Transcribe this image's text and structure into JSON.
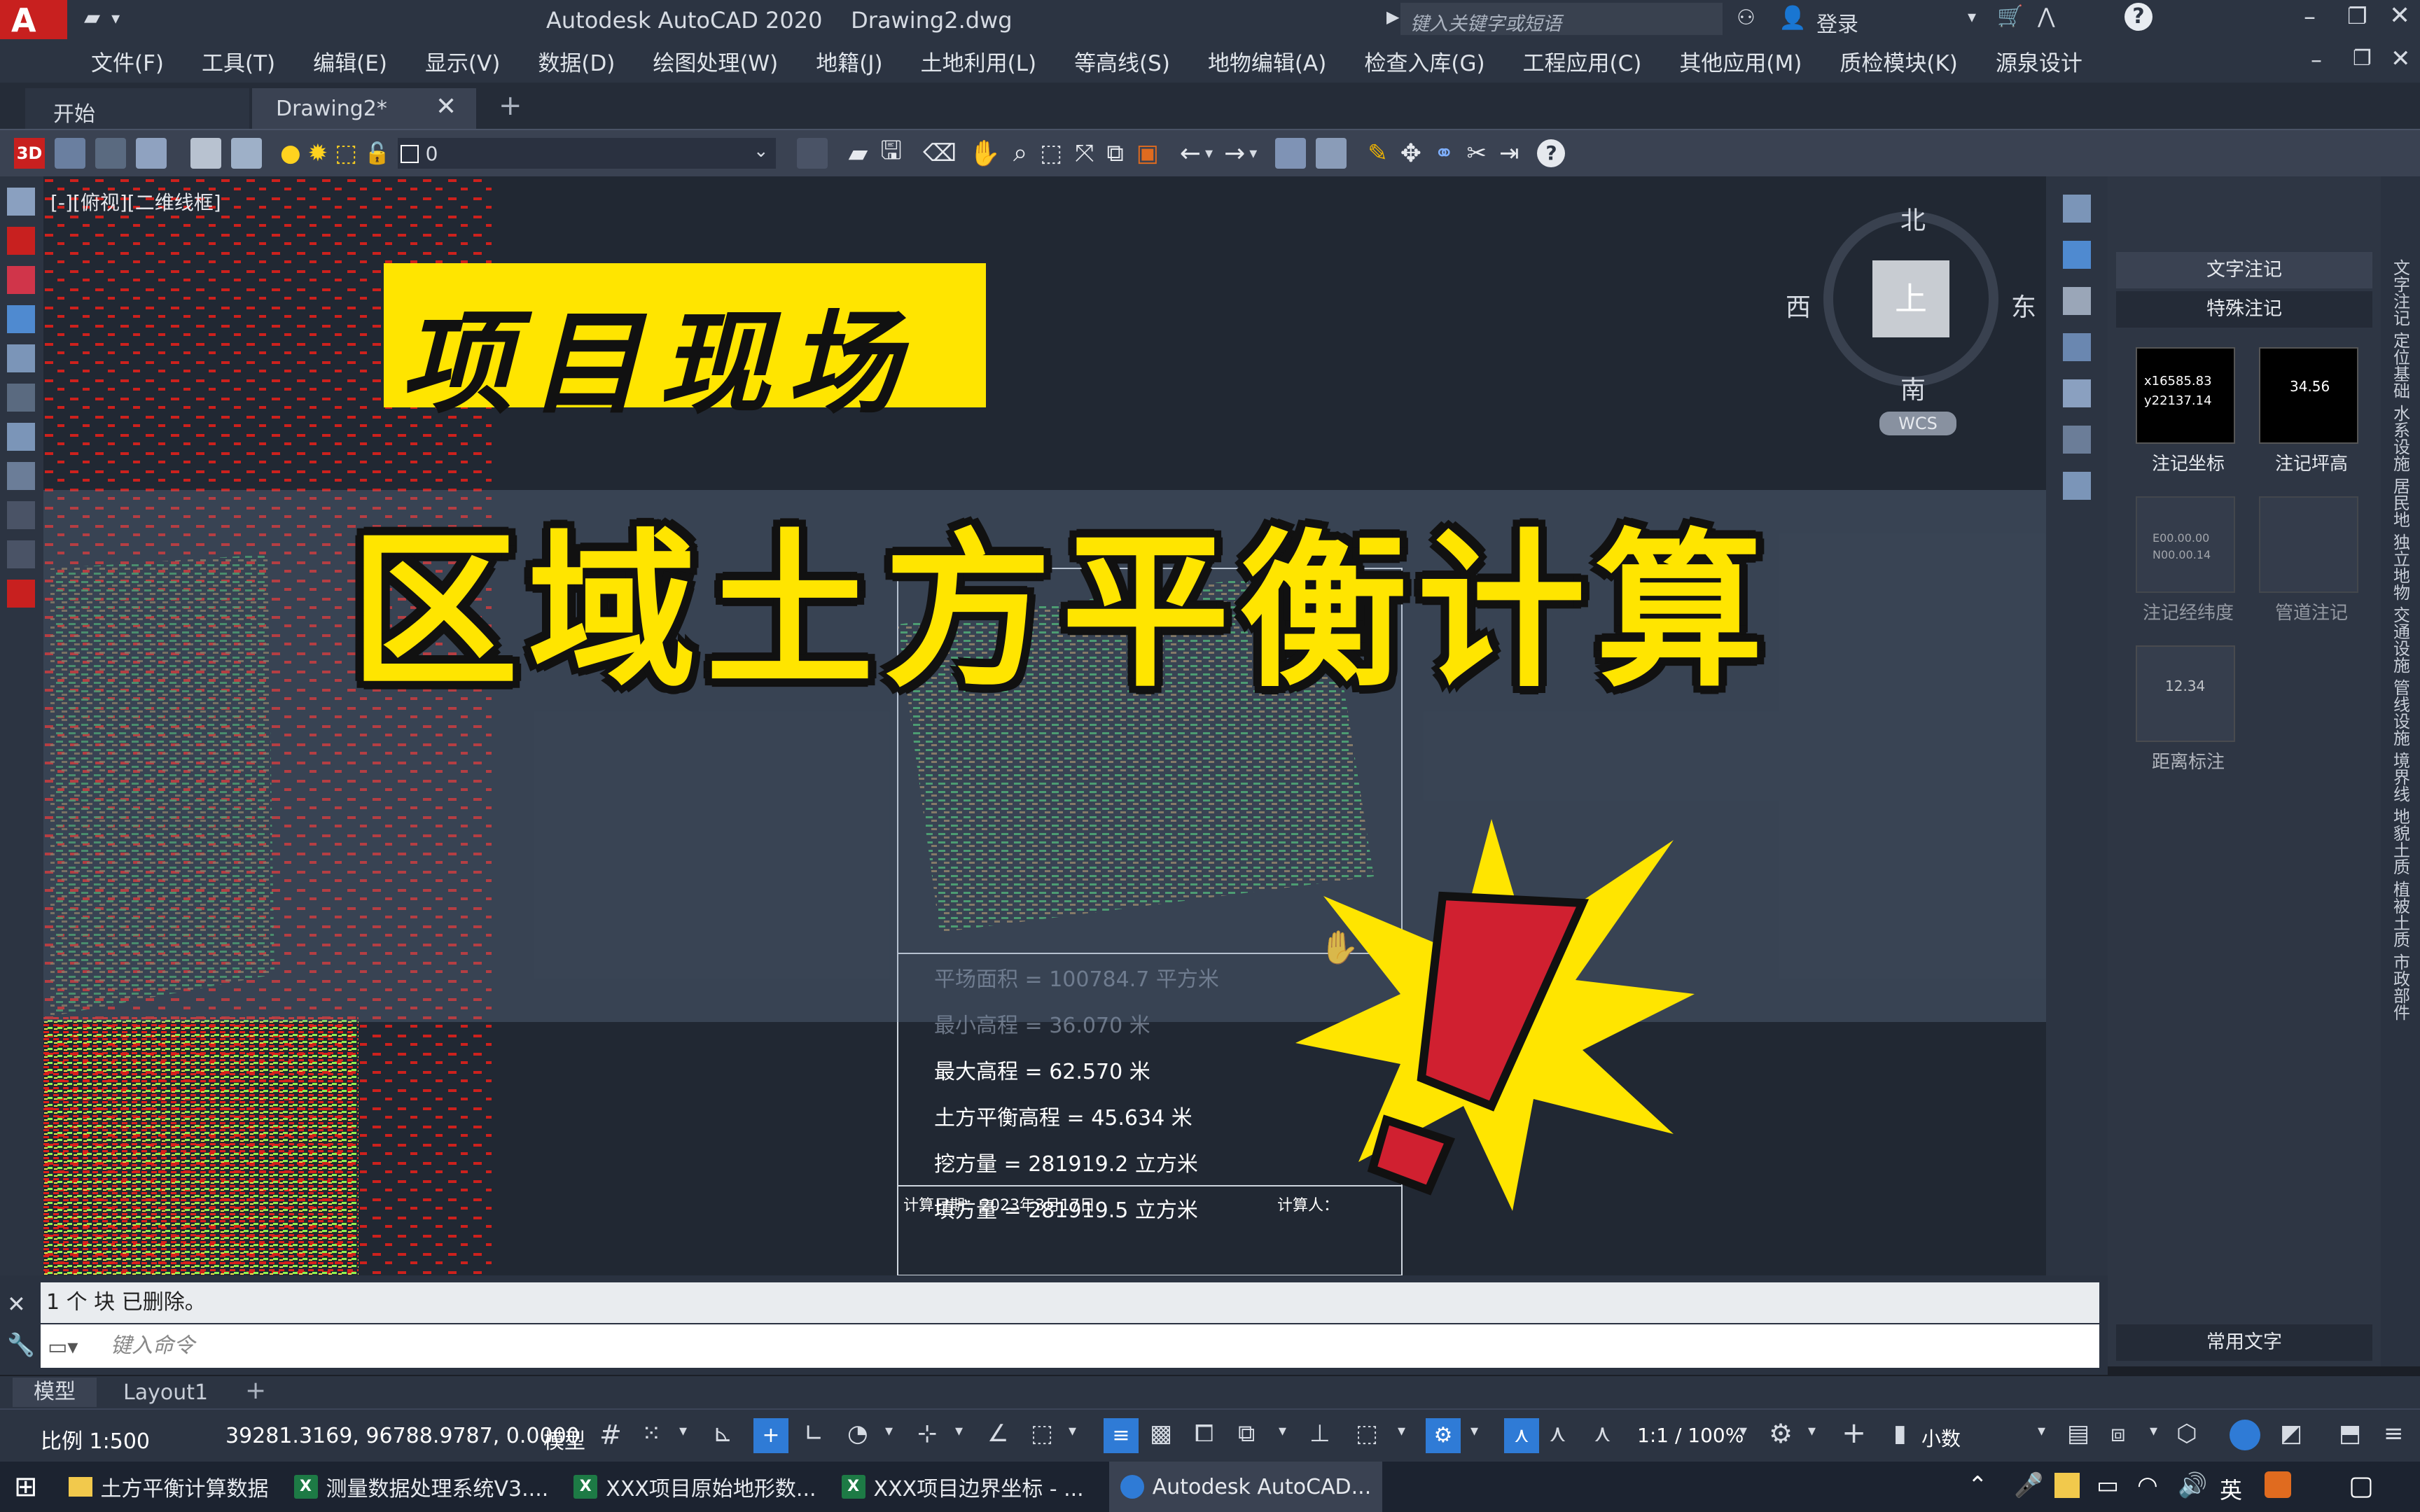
{
  "titlebar": {
    "app_title": "Autodesk AutoCAD 2020",
    "document": "Drawing2.dwg",
    "search_placeholder": "键入关键字或短语",
    "login": "登录"
  },
  "menus": [
    "文件(F)",
    "工具(T)",
    "编辑(E)",
    "显示(V)",
    "数据(D)",
    "绘图处理(W)",
    "地籍(J)",
    "土地利用(L)",
    "等高线(S)",
    "地物编辑(A)",
    "检查入库(G)",
    "工程应用(C)",
    "其他应用(M)",
    "质检模块(K)",
    "源泉设计"
  ],
  "tabs": {
    "start": "开始",
    "drawing": "Drawing2*"
  },
  "toolbar": {
    "layer_value": "0",
    "badge_3d": "3D"
  },
  "viewport": {
    "label": "[-][俯视][二维线框]"
  },
  "viewcube": {
    "north": "北",
    "south": "南",
    "east": "东",
    "west": "西",
    "top": "上",
    "wcs": "WCS"
  },
  "overlay": {
    "banner1": "项目现场",
    "banner2": "区域土方平衡计算"
  },
  "results": {
    "area": "平场面积  =  100784.7  平方米",
    "min_elev": "最小高程  =  36.070  米",
    "max_elev": "最大高程  =  62.570  米",
    "balance_elev": "土方平衡高程  =  45.634  米",
    "cut": "挖方量  =  281919.2  立方米",
    "fill": "填方量  =  281919.5  立方米",
    "date": "计算日期：2023年3月17日",
    "calculator": "计算人："
  },
  "palette": {
    "tab1": "文字注记",
    "tab2": "特殊注记",
    "items": [
      {
        "label": "注记坐标",
        "preview": [
          "x16585.83",
          "y22137.14"
        ]
      },
      {
        "label": "注记坪高",
        "preview": [
          "34.56"
        ]
      },
      {
        "label": "注记经纬度",
        "preview": [
          "E00.00.00",
          "N00.00.14"
        ]
      },
      {
        "label": "管道注记",
        "preview": [
          ""
        ]
      },
      {
        "label": "距离标注",
        "preview": [
          "12.34"
        ]
      }
    ],
    "footer": "常用文字"
  },
  "vert_tabs": [
    "文字注记",
    "定位基础",
    "水系设施",
    "居民地",
    "独立地物",
    "交通设施",
    "管线设施",
    "境界线",
    "地貌土质",
    "植被土质",
    "市政部件"
  ],
  "command": {
    "history": "1 个 块 已删除。",
    "placeholder": "键入命令"
  },
  "layouts": {
    "model": "模型",
    "layout1": "Layout1"
  },
  "status": {
    "scale": "比例 1:500",
    "coords": "39281.3169, 96788.9787, 0.0000",
    "mode": "模型",
    "annoscale": "1:1 / 100%",
    "units": "小数"
  },
  "taskbar": [
    {
      "label": "土方平衡计算数据",
      "icon": "folder"
    },
    {
      "label": "测量数据处理系统V3....",
      "icon": "excel"
    },
    {
      "label": "XXX项目原始地形数...",
      "icon": "excel"
    },
    {
      "label": "XXX项目边界坐标 - ...",
      "icon": "excel"
    },
    {
      "label": "Autodesk AutoCAD...",
      "icon": "autocad"
    }
  ],
  "tray": {
    "ime": "英"
  },
  "colors": {
    "banner_yellow": "#ffe500",
    "accent_blue": "#2f7bd6",
    "autocad_red": "#c8201f"
  }
}
